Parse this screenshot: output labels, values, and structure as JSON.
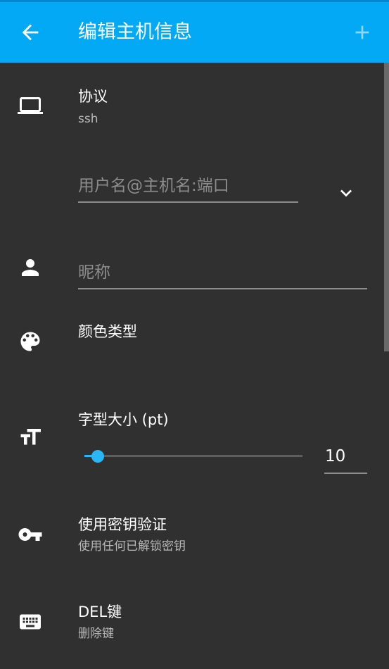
{
  "appbar": {
    "title": "编辑主机信息",
    "back_icon": "arrow-back-icon",
    "add_icon": "plus-icon"
  },
  "protocol": {
    "icon": "laptop-icon",
    "title": "协议",
    "value": "ssh"
  },
  "address": {
    "placeholder": "用户名@主机名:端口",
    "value": "",
    "dropdown_icon": "chevron-down-icon"
  },
  "nickname": {
    "icon": "person-icon",
    "placeholder": "昵称",
    "value": ""
  },
  "color": {
    "icon": "palette-icon",
    "title": "颜色类型"
  },
  "font_size": {
    "icon": "text-size-icon",
    "title": "字型大小 (pt)",
    "value": "10",
    "slider_fraction": 0.06
  },
  "pubkey": {
    "icon": "key-icon",
    "title": "使用密钥验证",
    "subtitle": "使用任何已解锁密钥"
  },
  "del_key": {
    "icon": "keyboard-icon",
    "title": "DEL键",
    "subtitle": "删除键"
  },
  "colors": {
    "appbar": "#03a9f4",
    "background": "#303030",
    "accent": "#29b6f6"
  }
}
